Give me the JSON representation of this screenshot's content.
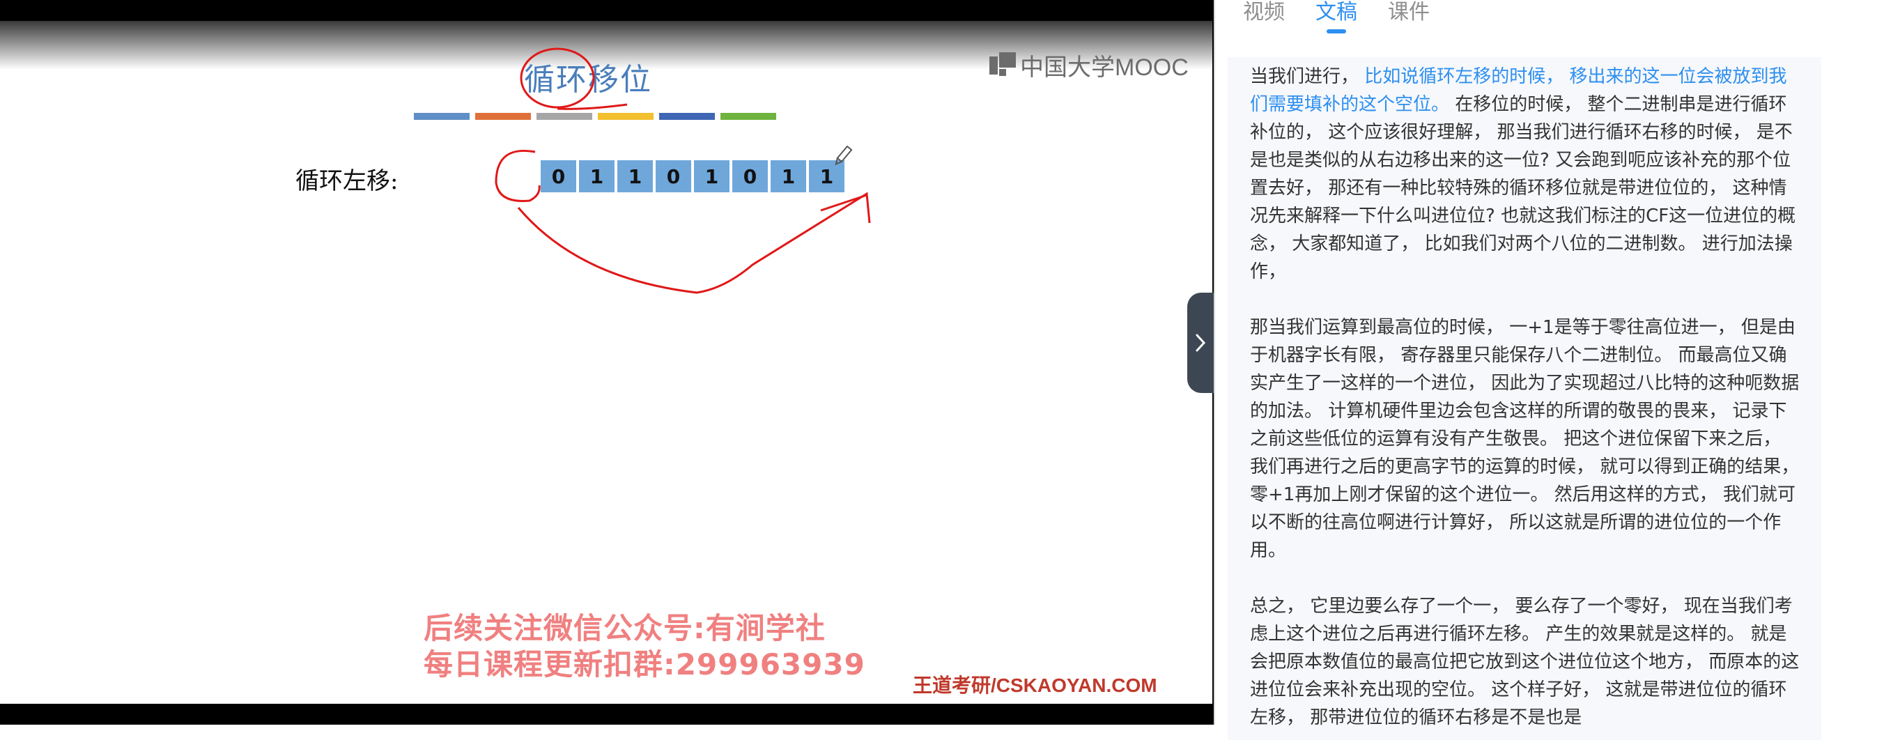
{
  "slide": {
    "title": "循环移位",
    "logo_text": "中国大学MOOC",
    "row_label": "循环左移:",
    "bits": [
      "0",
      "1",
      "1",
      "0",
      "1",
      "0",
      "1",
      "1"
    ],
    "color_bar": [
      "#5f8fc6",
      "#e0703a",
      "#a6a6a6",
      "#f2c02e",
      "#3e66b4",
      "#6fb33f"
    ],
    "watermark_line1": "后续关注微信公众号:有涧学社",
    "watermark_line2": "每日课程更新扣群:299963939",
    "footer_brand": "王道考研/CSKAOYAN.COM"
  },
  "panel": {
    "tabs": [
      {
        "label": "视频",
        "active": false
      },
      {
        "label": "文稿",
        "active": true
      },
      {
        "label": "课件",
        "active": false
      }
    ],
    "paragraphs": [
      {
        "prefix": "当我们进行，",
        "highlight": "比如说循环左移的时候， 移出来的这一位会被放到我们需要填补的这个空位。",
        "text": "在移位的时候， 整个二进制串是进行循环补位的， 这个应该很好理解， 那当我们进行循环右移的时候， 是不是也是类似的从右边移出来的这一位? 又会跑到呃应该补充的那个位置去好， 那还有一种比较特殊的循环移位就是带进位位的， 这种情况先来解释一下什么叫进位位? 也就这我们标注的CF这一位进位的概念， 大家都知道了， 比如我们对两个八位的二进制数。 进行加法操作，"
      },
      {
        "prefix": "",
        "highlight": "",
        "text": "那当我们运算到最高位的时候， 一+1是等于零往高位进一， 但是由于机器字长有限， 寄存器里只能保存八个二进制位。 而最高位又确实产生了一这样的一个进位， 因此为了实现超过八比特的这种呃数据的加法。 计算机硬件里边会包含这样的所谓的敬畏的畏来， 记录下之前这些低位的运算有没有产生敬畏。 把这个进位保留下来之后， 我们再进行之后的更高字节的运算的时候， 就可以得到正确的结果， 零+1再加上刚才保留的这个进位一。 然后用这样的方式， 我们就可以不断的往高位啊进行计算好， 所以这就是所谓的进位位的一个作用。"
      },
      {
        "prefix": "",
        "highlight": "",
        "text": "总之， 它里边要么存了一个一， 要么存了一个零好， 现在当我们考虑上这个进位之后再进行循环左移。 产生的效果就是这样的。 就是会把原本数值位的最高位把它放到这个进位位这个地方， 而原本的这进位位会来补充出现的空位。 这个样子好， 这就是带进位位的循环左移， 那带进位位的循环右移是不是也是"
      }
    ]
  }
}
